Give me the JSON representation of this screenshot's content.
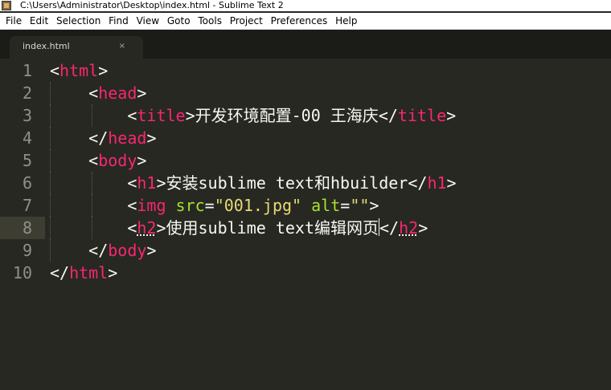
{
  "window": {
    "title": "C:\\Users\\Administrator\\Desktop\\index.html - Sublime Text 2",
    "app_icon": "sublime-text-icon"
  },
  "menu": {
    "file": "File",
    "edit": "Edit",
    "selection": "Selection",
    "find": "Find",
    "view": "View",
    "goto": "Goto",
    "tools": "Tools",
    "project": "Project",
    "preferences": "Preferences",
    "help": "Help"
  },
  "tab": {
    "label": "index.html",
    "close": "×"
  },
  "theme": {
    "background": "#272822",
    "tag": "#f92672",
    "attribute": "#a6e22e",
    "string": "#e6db74",
    "text": "#f8f8f2",
    "gutter": "#90908a",
    "current_line": "#3e3d32"
  },
  "editor": {
    "current_line": 8,
    "line_numbers": [
      "1",
      "2",
      "3",
      "4",
      "5",
      "6",
      "7",
      "8",
      "9",
      "10"
    ],
    "tokens": {
      "html": "html",
      "head": "head",
      "title": "title",
      "body": "body",
      "h1": "h1",
      "img": "img",
      "src": "src",
      "alt": "alt",
      "h2": "h2",
      "title_text": "开发环境配置-00 王海庆",
      "h1_text": "安装sublime text和hbuilder",
      "src_value": "\"001.jpg\"",
      "alt_value": "\"\"",
      "h2_text": "使用sublime text编辑网页"
    }
  }
}
